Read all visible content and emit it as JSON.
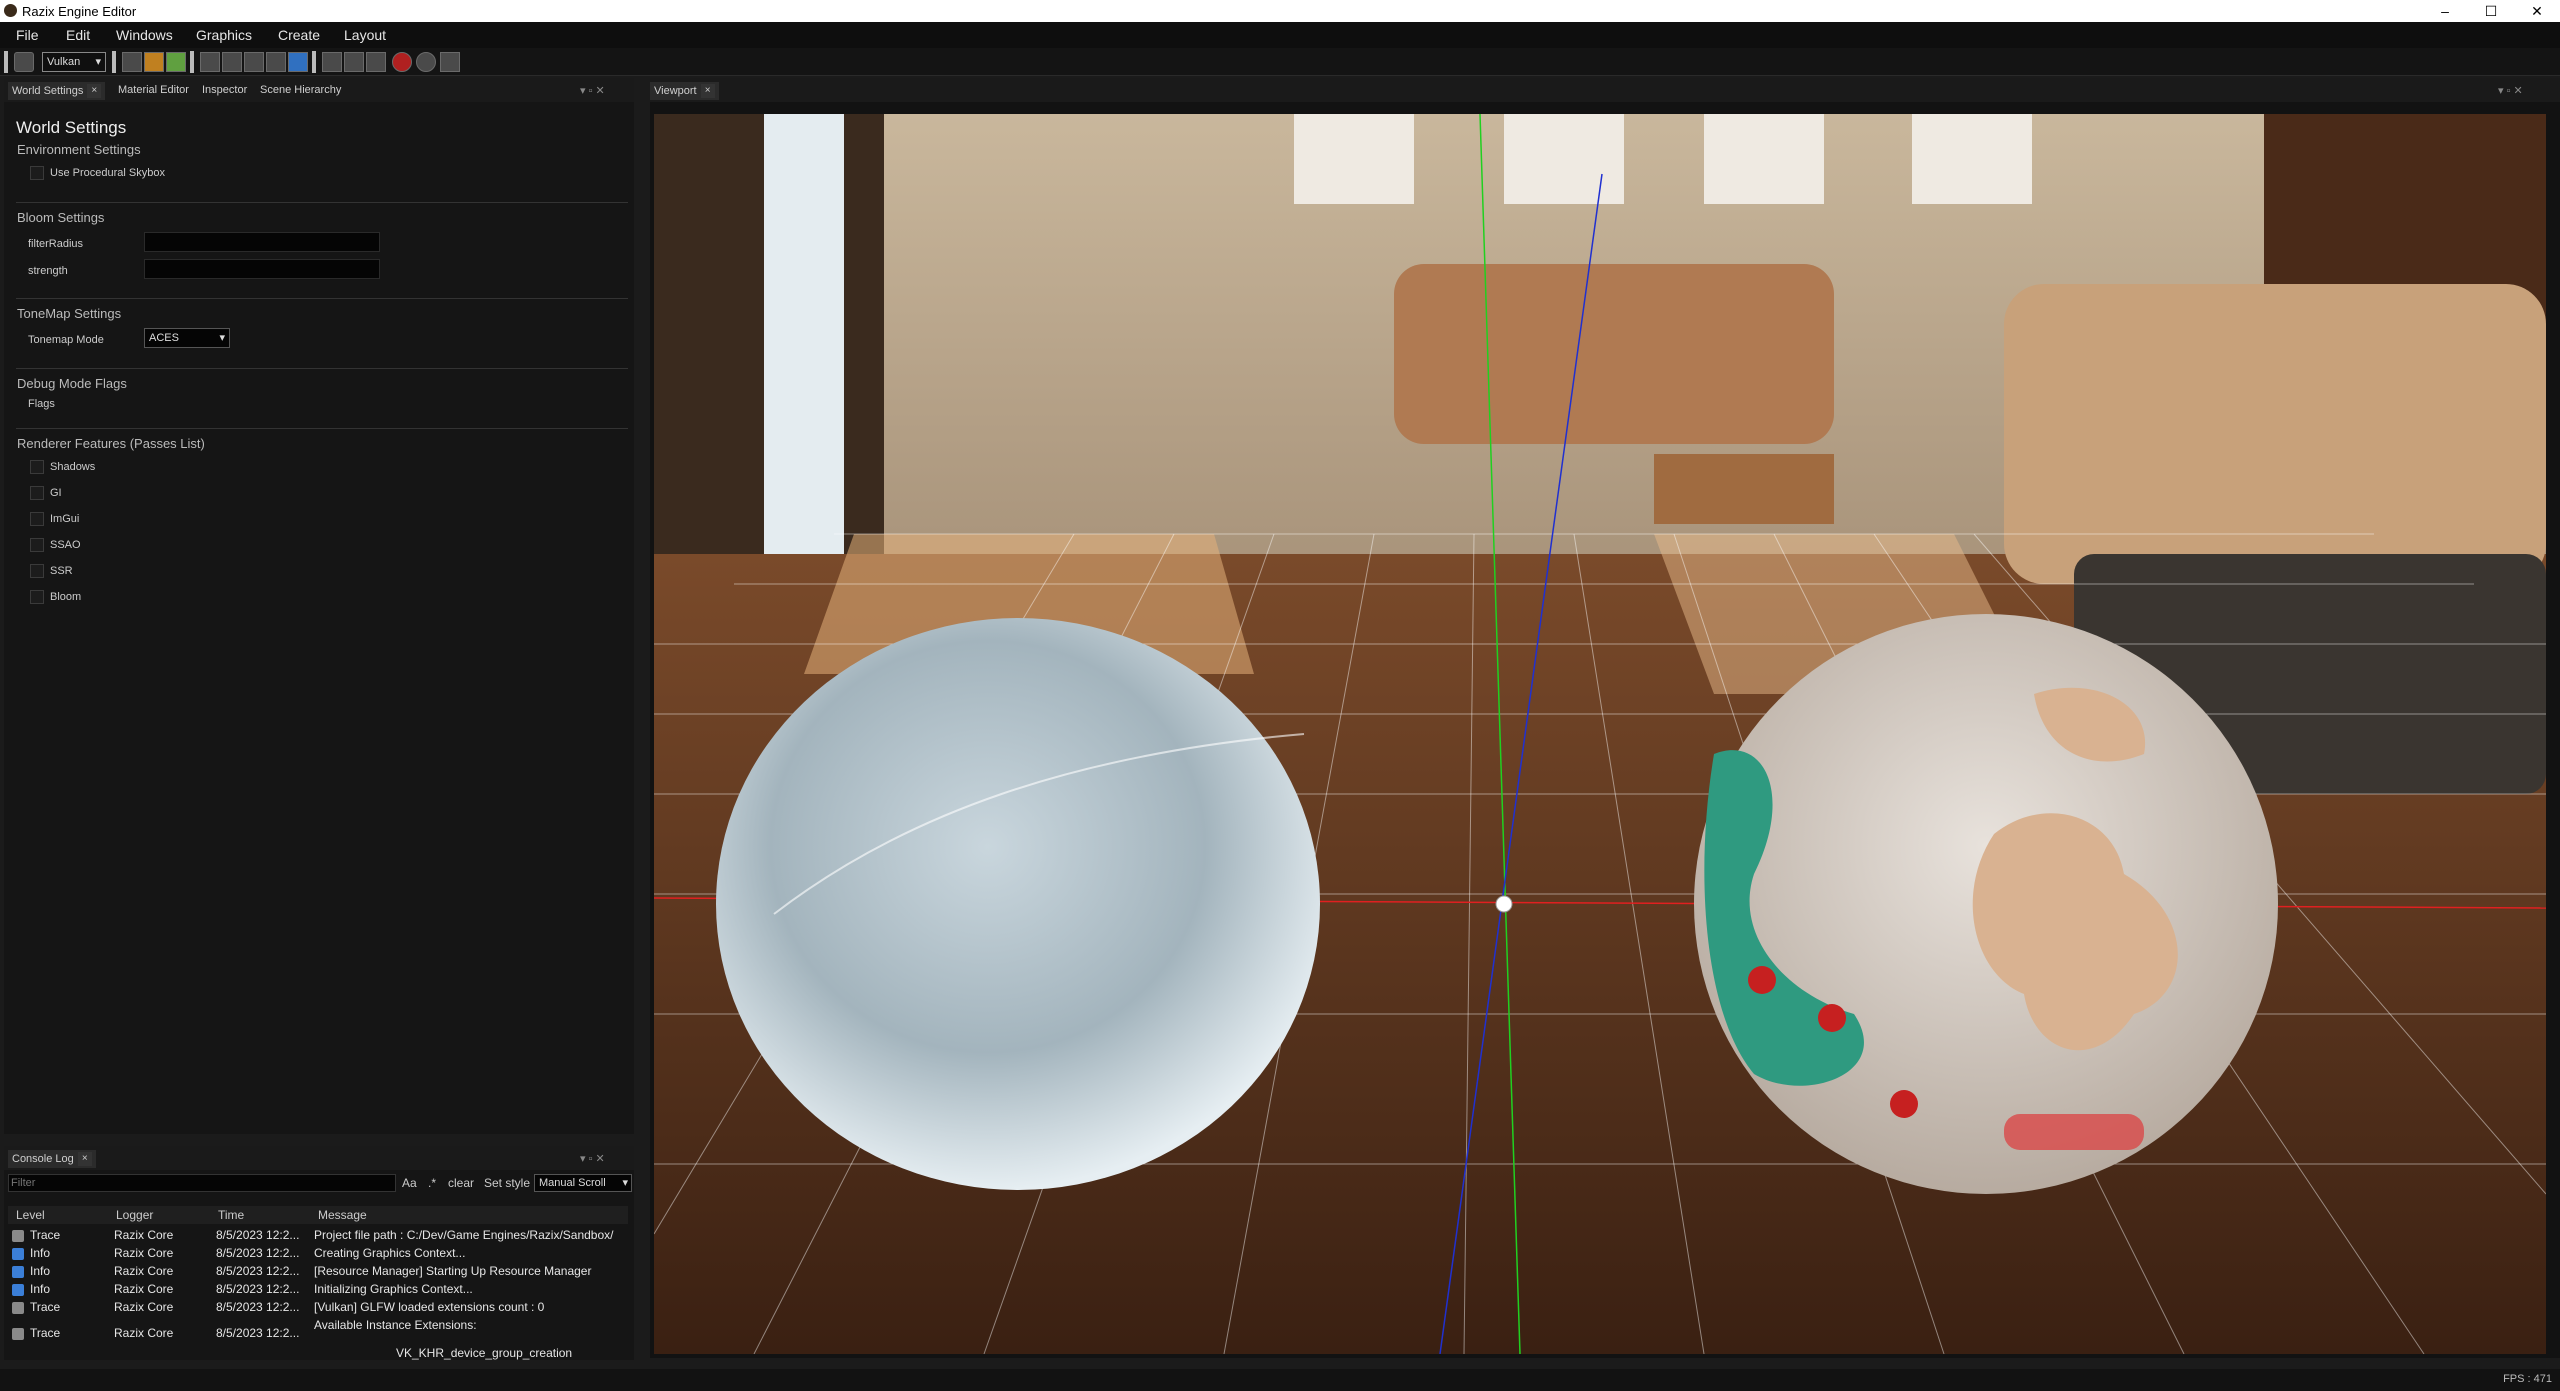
{
  "window": {
    "title": "Razix Engine Editor",
    "minimize": "–",
    "maximize": "☐",
    "close": "✕"
  },
  "menubar": [
    "File",
    "Edit",
    "Windows",
    "Graphics",
    "Create",
    "Layout"
  ],
  "toolbar": {
    "graphics_api": "Vulkan"
  },
  "left_tabs": [
    "World Settings",
    "Material Editor",
    "Inspector",
    "Scene Hierarchy"
  ],
  "world_settings": {
    "title": "World Settings",
    "environment": {
      "heading": "Environment Settings",
      "procedural_skybox": "Use Procedural Skybox"
    },
    "bloom": {
      "heading": "Bloom Settings",
      "filter_radius": "filterRadius",
      "strength": "strength"
    },
    "tonemap": {
      "heading": "ToneMap Settings",
      "mode_label": "Tonemap Mode",
      "mode_value": "ACES"
    },
    "debug": {
      "heading": "Debug Mode Flags",
      "flags": "Flags"
    },
    "renderer": {
      "heading": "Renderer Features (Passes List)",
      "passes": [
        "Shadows",
        "GI",
        "ImGui",
        "SSAO",
        "SSR",
        "Bloom"
      ]
    }
  },
  "console": {
    "tab": "Console Log",
    "filter_placeholder": "Filter",
    "case_button": "Aa",
    "regex_button": ".*",
    "clear_button": "clear",
    "set_style_button": "Set style",
    "scroll_mode": "Manual Scroll",
    "columns": [
      "Level",
      "Logger",
      "Time",
      "Message"
    ],
    "rows": [
      {
        "level": "Trace",
        "logger": "Razix Core",
        "time": "8/5/2023 12:2...",
        "message": "Project file path : C:/Dev/Game Engines/Razix/Sandbox/"
      },
      {
        "level": "Info",
        "logger": "Razix Core",
        "time": "8/5/2023 12:2...",
        "message": "Creating Graphics Context..."
      },
      {
        "level": "Info",
        "logger": "Razix Core",
        "time": "8/5/2023 12:2...",
        "message": "[Resource Manager] Starting Up Resource Manager"
      },
      {
        "level": "Info",
        "logger": "Razix Core",
        "time": "8/5/2023 12:2...",
        "message": "Initializing Graphics Context..."
      },
      {
        "level": "Trace",
        "logger": "Razix Core",
        "time": "8/5/2023 12:2...",
        "message": "[Vulkan] GLFW loaded extensions count : 0"
      },
      {
        "level": "Trace",
        "logger": "Razix Core",
        "time": "8/5/2023 12:2...",
        "message": "Available Instance Extensions:"
      }
    ],
    "extra_line": "VK_KHR_device_group_creation"
  },
  "viewport": {
    "tab": "Viewport"
  },
  "status": {
    "fps": "FPS : 471"
  },
  "colors": {
    "trace": "#8a8a8a",
    "info": "#3b7fd8",
    "grid": "#ffffff",
    "x_axis": "#e02020",
    "y_axis": "#20d020",
    "z_axis": "#2030d0"
  }
}
